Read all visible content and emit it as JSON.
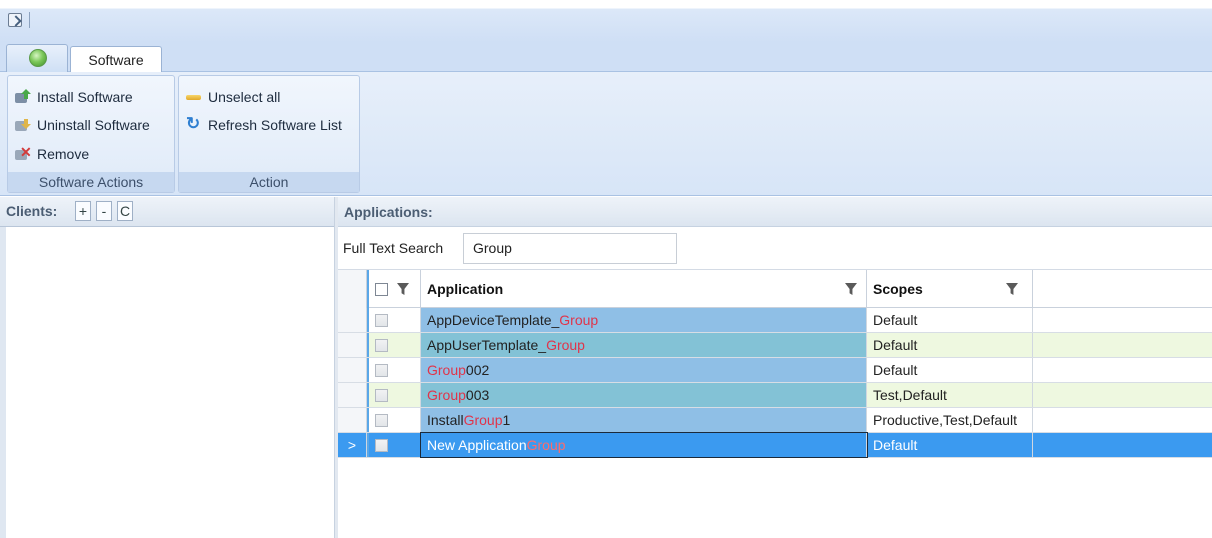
{
  "ribbon": {
    "tab_label": "Software",
    "groups": [
      {
        "label": "Software Actions",
        "buttons": [
          "Install Software",
          "Uninstall Software",
          "Remove"
        ]
      },
      {
        "label": "Action",
        "buttons": [
          "Unselect all",
          "Refresh Software List"
        ]
      }
    ]
  },
  "clients": {
    "label": "Clients:",
    "buttons": [
      "+",
      "-",
      "C"
    ]
  },
  "applications": {
    "label": "Applications:",
    "search_label": "Full Text Search",
    "search_value": "Group",
    "columns": [
      "Application",
      "Scopes"
    ],
    "rows": [
      {
        "app_prefix": "AppDeviceTemplate_",
        "app_match": "Group",
        "app_suffix": "",
        "scopes": "Default",
        "selected": false
      },
      {
        "app_prefix": "AppUserTemplate_",
        "app_match": "Group",
        "app_suffix": "",
        "scopes": "Default",
        "selected": false
      },
      {
        "app_prefix": "",
        "app_match": "Group",
        "app_suffix": "002",
        "scopes": "Default",
        "selected": false
      },
      {
        "app_prefix": "",
        "app_match": "Group",
        "app_suffix": "003",
        "scopes": "Test,Default",
        "selected": false
      },
      {
        "app_prefix": "Install",
        "app_match": "Group",
        "app_suffix": "1",
        "scopes": "Productive,Test,Default",
        "selected": false
      },
      {
        "app_prefix": "New Application ",
        "app_match": "Group",
        "app_suffix": "",
        "scopes": "Default",
        "selected": true
      }
    ],
    "current_row_marker": ">"
  },
  "colors": {
    "app_cell": "#8fbfe6",
    "app_cell_alt": "#83c2d6",
    "row_alt": "#eef8e0",
    "selected_row": "#3b9af0",
    "highlight_text": "#e0344a"
  }
}
